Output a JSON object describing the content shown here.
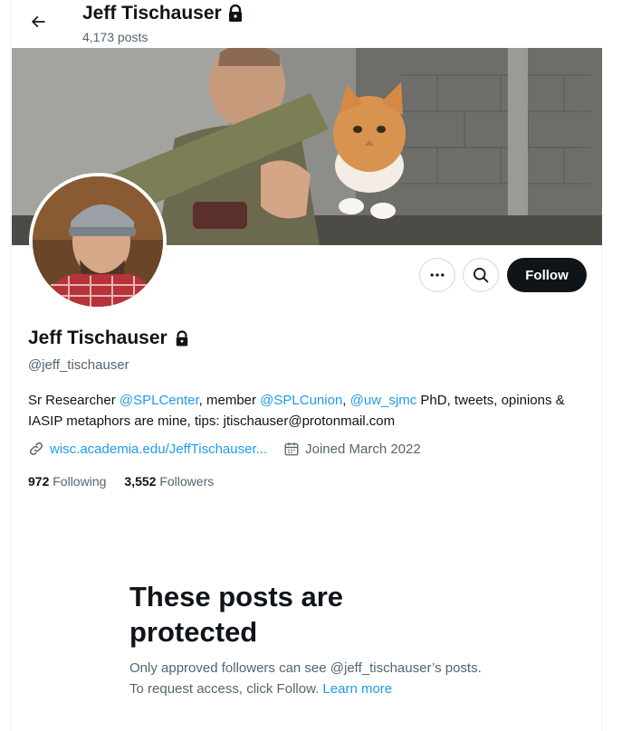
{
  "header": {
    "title": "Jeff Tischauser",
    "posts_count": "4,173 posts"
  },
  "profile": {
    "name": "Jeff Tischauser",
    "handle": "@jeff_tischauser",
    "bio": {
      "part1": "Sr Researcher ",
      "mention1": "@SPLCenter",
      "part2": ", member ",
      "mention2": "@SPLCunion",
      "part3": ", ",
      "mention3": "@uw_sjmc",
      "part4": " PhD, tweets, opinions & IASIP metaphors are mine, tips: jtischauser@protonmail.com"
    },
    "website": "wisc.academia.edu/JeffTischauser...",
    "joined": "Joined March 2022",
    "following_count": "972",
    "following_label": "Following",
    "followers_count": "3,552",
    "followers_label": "Followers"
  },
  "actions": {
    "follow_label": "Follow",
    "more_icon": "more-icon",
    "search_icon": "search-icon"
  },
  "protected": {
    "title": "These posts are protected",
    "text": "Only approved followers can see @jeff_tischauser’s posts. To request access, click Follow.",
    "learn_more": "Learn more"
  },
  "colors": {
    "accent": "#1d9bf0",
    "text": "#0f1419",
    "secondary": "#536471",
    "button_dark": "#0f1419"
  }
}
